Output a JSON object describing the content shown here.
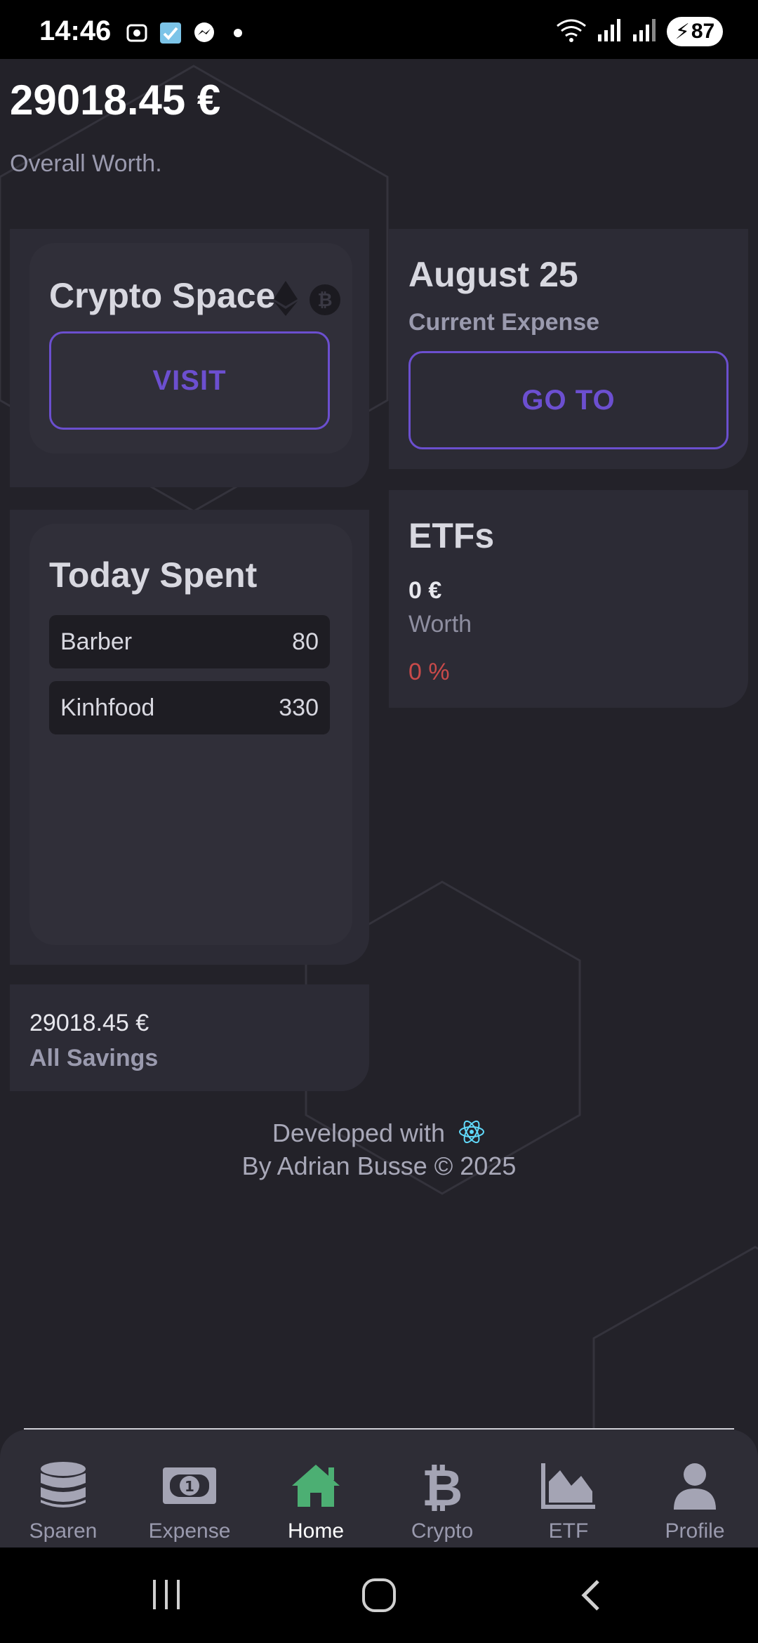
{
  "status_bar": {
    "time": "14:46",
    "battery": "87",
    "icons": [
      "screenshot-icon",
      "app-check-icon",
      "messenger-icon",
      "dot-icon",
      "wifi-icon",
      "signal-icon",
      "signal-icon",
      "battery-icon"
    ]
  },
  "header": {
    "worth_value": "29018.45 €",
    "worth_label": "Overall Worth."
  },
  "crypto_card": {
    "title": "Crypto Space",
    "button_label": "VISIT",
    "icons": [
      "ethereum-icon",
      "bitcoin-icon"
    ]
  },
  "expense_card": {
    "title": "August 25",
    "subtitle": "Current Expense",
    "button_label": "GO TO"
  },
  "today_spent": {
    "title": "Today Spent",
    "items": [
      {
        "name": "Barber",
        "amount": "80"
      },
      {
        "name": "Kinhfood",
        "amount": "330"
      }
    ]
  },
  "etf_card": {
    "title": "ETFs",
    "value": "0 €",
    "label": "Worth",
    "percent": "0 %"
  },
  "savings_card": {
    "value": "29018.45 €",
    "label": "All Savings"
  },
  "footer": {
    "developed_with": "Developed with",
    "credit": "By Adrian Busse © 2025",
    "icon": "react-icon"
  },
  "bottom_nav": {
    "items": [
      {
        "label": "Sparen",
        "icon": "database-icon"
      },
      {
        "label": "Expense",
        "icon": "money-bill-icon"
      },
      {
        "label": "Home",
        "icon": "home-icon"
      },
      {
        "label": "Crypto",
        "icon": "bitcoin-icon"
      },
      {
        "label": "ETF",
        "icon": "area-chart-icon"
      },
      {
        "label": "Profile",
        "icon": "user-icon"
      }
    ],
    "active": "Home"
  },
  "colors": {
    "background": "#232229",
    "card": "#2c2b35",
    "accent": "#6b4fcf",
    "active_nav": "#4caf73",
    "negative": "#c94a4a",
    "muted": "#9a9aae"
  }
}
